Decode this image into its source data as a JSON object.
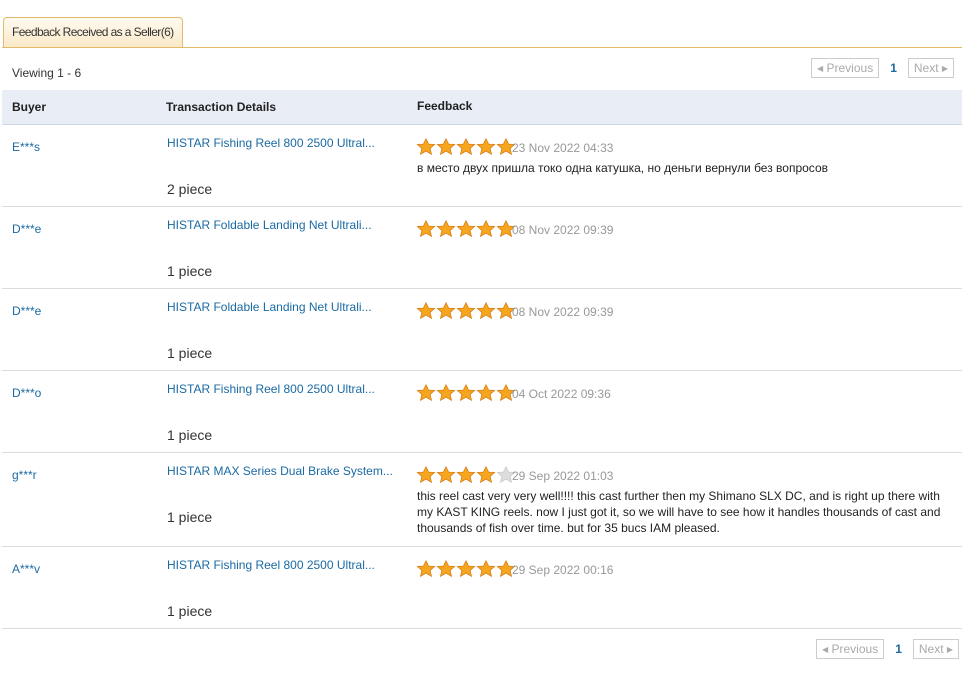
{
  "tab": {
    "label": "Feedback Received as a Seller(6)"
  },
  "viewing": "Viewing 1 - 6",
  "pagination": {
    "previous": "Previous",
    "page": "1",
    "next": "Next"
  },
  "columns": {
    "buyer": "Buyer",
    "details": "Transaction Details",
    "feedback": "Feedback"
  },
  "colors": {
    "link": "#1a6aa3",
    "star_on": "#f5a51e",
    "star_off": "#dddddd",
    "tab_border": "#e3b96a",
    "header_bg": "#e8edf6"
  },
  "icons": {
    "star": "star-icon",
    "arrow_left": "arrow-left-icon",
    "arrow_right": "arrow-right-icon"
  },
  "rows": [
    {
      "buyer": "E***s",
      "product": "HISTAR Fishing Reel 800 2500 Ultral...",
      "quantity": "2 piece",
      "rating": 5,
      "date": "23 Nov 2022 04:33",
      "comment": "в место двух пришла токо одна катушка, но деньги вернули без вопросов"
    },
    {
      "buyer": "D***e",
      "product": "HISTAR Foldable Landing Net Ultrali...",
      "quantity": "1 piece",
      "rating": 5,
      "date": "08 Nov 2022 09:39",
      "comment": ""
    },
    {
      "buyer": "D***e",
      "product": "HISTAR Foldable Landing Net Ultrali...",
      "quantity": "1 piece",
      "rating": 5,
      "date": "08 Nov 2022 09:39",
      "comment": ""
    },
    {
      "buyer": "D***o",
      "product": "HISTAR Fishing Reel 800 2500 Ultral...",
      "quantity": "1 piece",
      "rating": 5,
      "date": "04 Oct 2022 09:36",
      "comment": ""
    },
    {
      "buyer": "g***r",
      "product": "HISTAR MAX Series Dual Brake System...",
      "quantity": "1 piece",
      "rating": 4,
      "date": "29 Sep 2022 01:03",
      "comment": "this reel cast very very well!!!! this cast further then my Shimano SLX DC, and is right up there with my KAST KING reels. now I just got it, so we will have to see how it handles thousands of cast and thousands of fish over time. but for 35 bucs IAM pleased."
    },
    {
      "buyer": "A***v",
      "product": "HISTAR Fishing Reel 800 2500 Ultral...",
      "quantity": "1 piece",
      "rating": 5,
      "date": "29 Sep 2022 00:16",
      "comment": ""
    }
  ]
}
